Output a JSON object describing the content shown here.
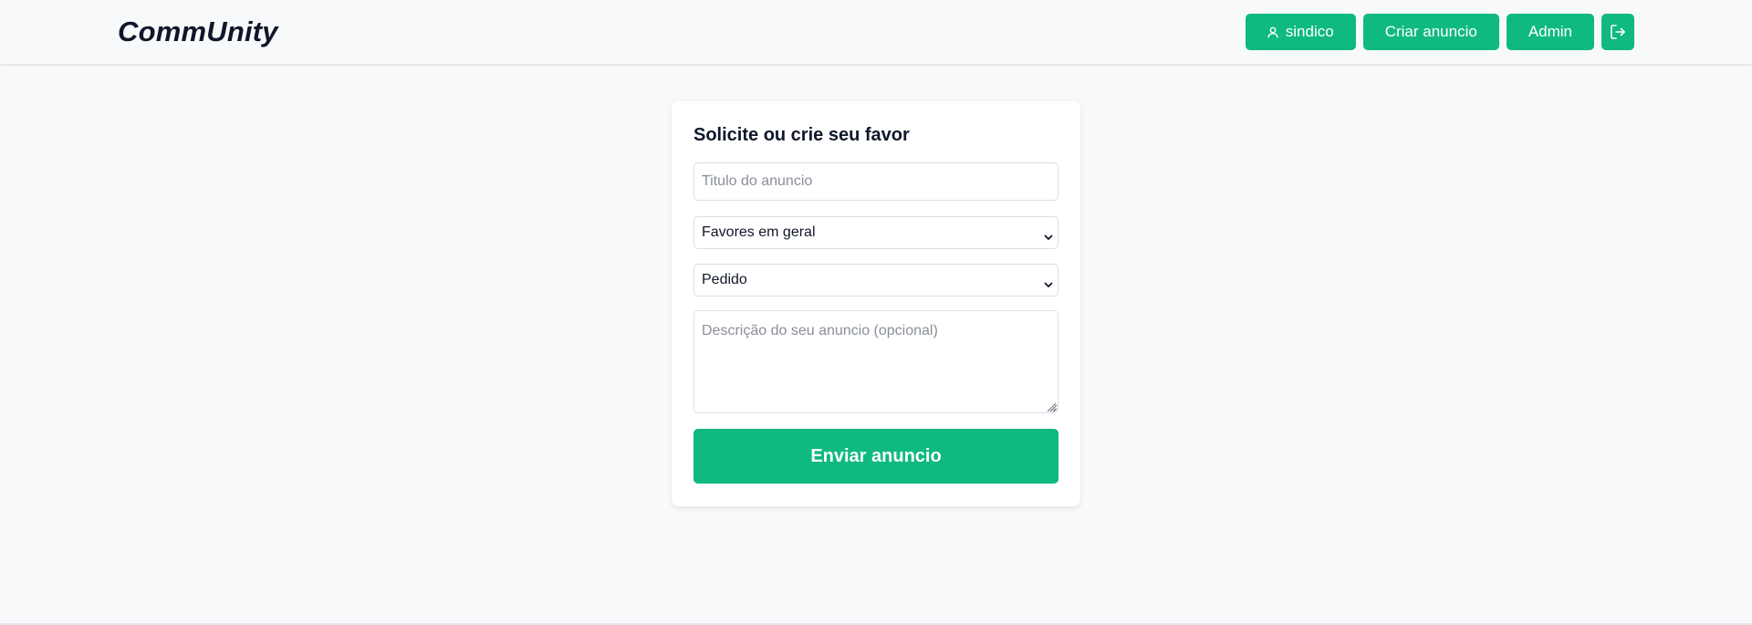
{
  "header": {
    "brand": "CommUnity",
    "user_button_label": "sindico",
    "user_icon": "user-icon",
    "create_button_label": "Criar anuncio",
    "admin_button_label": "Admin",
    "logout_icon": "logout-icon",
    "accent_color": "#10b981"
  },
  "form": {
    "title": "Solicite ou crie seu favor",
    "title_placeholder": "Titulo do anuncio",
    "title_value": "",
    "category_selected": "Favores em geral",
    "type_selected": "Pedido",
    "description_placeholder": "Descrição do seu anuncio (opcional)",
    "description_value": "",
    "submit_label": "Enviar anuncio"
  }
}
